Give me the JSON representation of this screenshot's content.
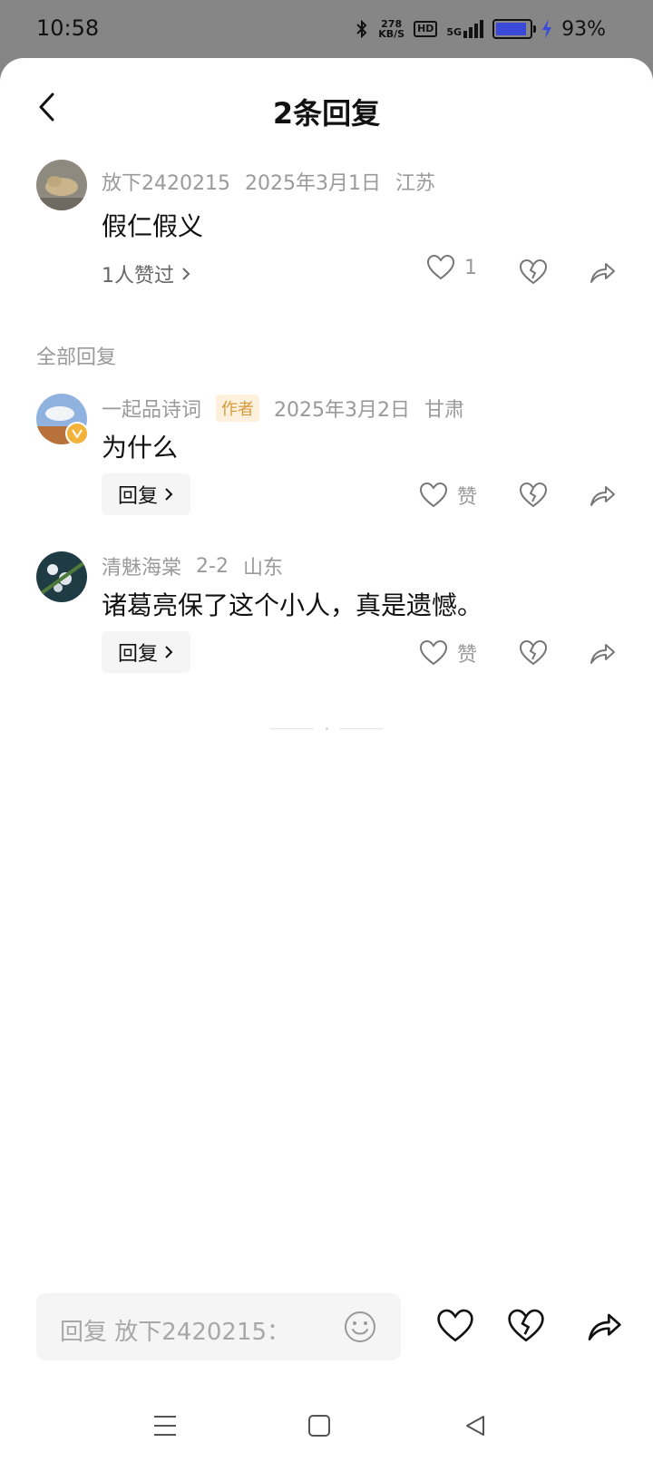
{
  "status_bar": {
    "time": "10:58",
    "net_speed_value": "278",
    "net_speed_unit": "KB/S",
    "hd_label": "HD",
    "network_type": "5G",
    "battery_percent": "93%",
    "battery_level": 0.93,
    "battery_color": "#3a49d9"
  },
  "header": {
    "title": "2条回复"
  },
  "main_comment": {
    "author": "放下2420215",
    "date": "2025年3月1日",
    "location": "江苏",
    "text": "假仁假义",
    "likers_text": "1人赞过",
    "like_count": "1"
  },
  "replies_section": {
    "label": "全部回复"
  },
  "replies": [
    {
      "author": "一起品诗词",
      "tag": "作者",
      "date": "2025年3月2日",
      "location": "甘肃",
      "text": "为什么",
      "reply_label": "回复",
      "like_label": "赞"
    },
    {
      "author": "清魅海棠",
      "date": "2-2",
      "location": "山东",
      "text": "诸葛亮保了这个小人，真是遗憾。",
      "reply_label": "回复",
      "like_label": "赞"
    }
  ],
  "input_bar": {
    "placeholder": "回复 放下2420215："
  },
  "icons": {
    "back": "chevron-left-icon",
    "like": "heart-icon",
    "dislike": "broken-heart-icon",
    "share": "share-arrow-icon",
    "emoji": "smiley-icon",
    "verified": "verified-badge-icon",
    "nav_menu": "menu-icon",
    "nav_home": "home-icon",
    "nav_back": "triangle-back-icon"
  },
  "colors": {
    "author_tag_text": "#d49a3a",
    "author_tag_bg": "#fdf1dd",
    "verified_badge": "#f2b33a"
  }
}
